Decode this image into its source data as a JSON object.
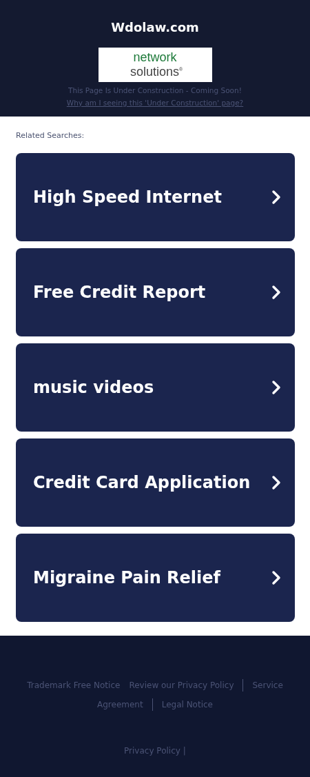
{
  "header": {
    "title": "Wdolaw.com",
    "logo": {
      "line_1": "network",
      "line_2": "solutions",
      "mark": "®"
    },
    "notice": "This Page Is Under Construction - Coming Soon!",
    "why_link": "Why am I seeing this 'Under Construction' page?"
  },
  "related": {
    "heading": "Related Searches:",
    "items": [
      {
        "label": "High Speed Internet"
      },
      {
        "label": "Free Credit Report"
      },
      {
        "label": "music videos"
      },
      {
        "label": "Credit Card Application"
      },
      {
        "label": "Migraine Pain Relief"
      }
    ]
  },
  "footer": {
    "link_lines": [
      [
        {
          "label": "Trademark Free Notice",
          "divider_before": false
        },
        {
          "label": "Review our Privacy Policy",
          "divider_before": false
        },
        {
          "label": "Service",
          "divider_before": true
        }
      ],
      [
        {
          "label": "Agreement",
          "divider_before": false
        },
        {
          "label": "Legal Notice",
          "divider_before": true
        }
      ]
    ],
    "bottom_link": "Privacy Policy",
    "bottom_separator": "|"
  }
}
